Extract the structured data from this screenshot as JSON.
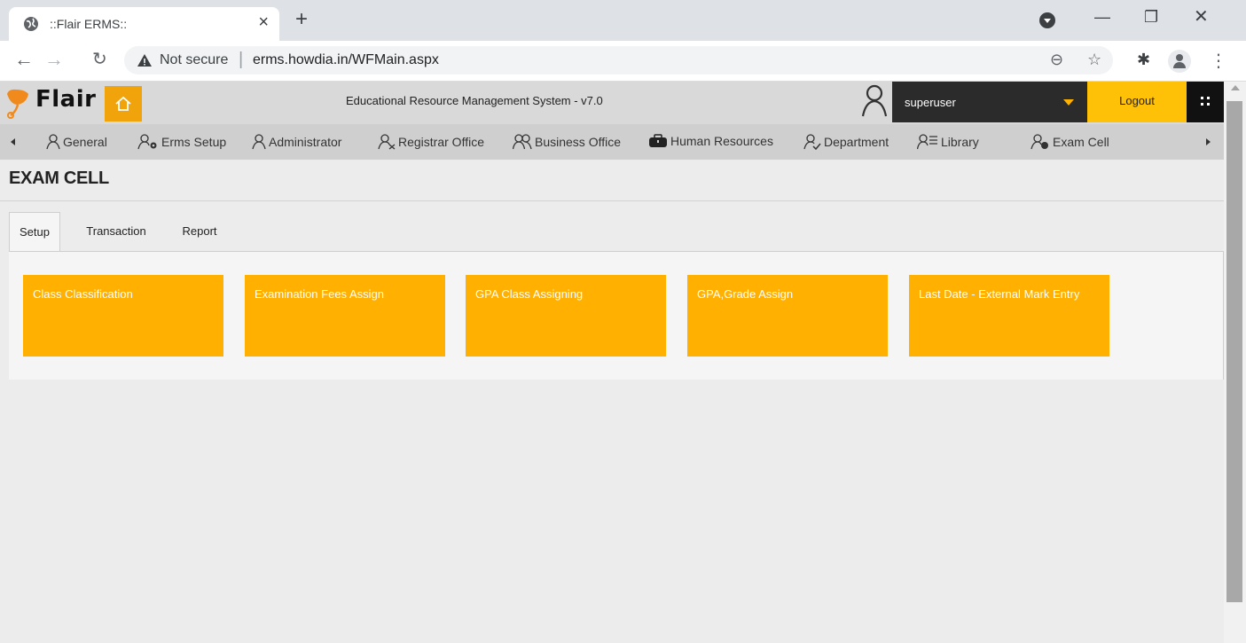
{
  "browser": {
    "tab_title": "::Flair ERMS::",
    "not_secure": "Not secure",
    "url": "erms.howdia.in/WFMain.aspx"
  },
  "app": {
    "brand": "Flair",
    "system_title": "Educational Resource Management System - v7.0",
    "username": "superuser",
    "logout_label": "Logout",
    "accent_color": "#ffb000",
    "home_color": "#f0a30a"
  },
  "menu": {
    "items": [
      {
        "label": "General",
        "icon": "user-icon"
      },
      {
        "label": "Erms Setup",
        "icon": "user-gear-icon"
      },
      {
        "label": "Administrator",
        "icon": "user-icon"
      },
      {
        "label": "Registrar Office",
        "icon": "user-cross-icon"
      },
      {
        "label": "Business Office",
        "icon": "users-icon"
      },
      {
        "label": "Human Resources",
        "icon": "briefcase-icon"
      },
      {
        "label": "Department",
        "icon": "user-check-icon"
      },
      {
        "label": "Library",
        "icon": "user-list-icon"
      },
      {
        "label": "Exam Cell",
        "icon": "user-settings-icon"
      }
    ]
  },
  "page": {
    "title": "EXAM CELL",
    "tabs": [
      "Setup",
      "Transaction",
      "Report"
    ],
    "active_tab": "Setup",
    "tiles": [
      "Class Classification",
      "Examination Fees Assign",
      "GPA Class Assigning",
      "GPA,Grade Assign",
      "Last Date - External Mark Entry"
    ]
  }
}
